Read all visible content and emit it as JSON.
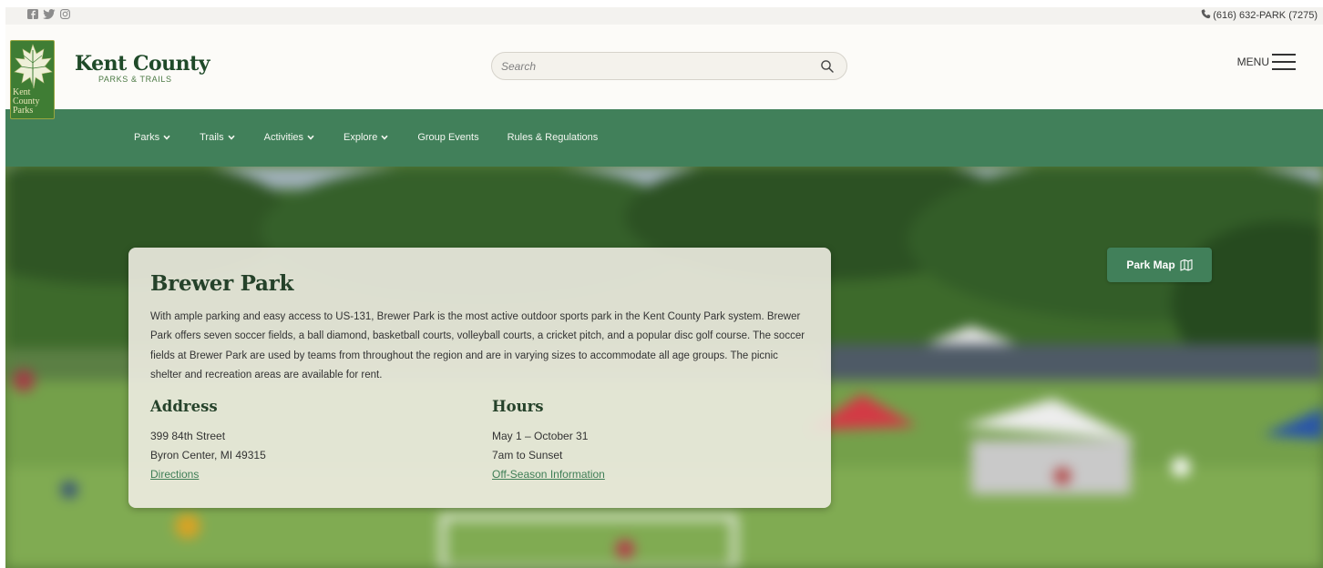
{
  "utility": {
    "social": [
      {
        "name": "facebook-icon"
      },
      {
        "name": "twitter-icon"
      },
      {
        "name": "instagram-icon"
      }
    ],
    "phone": "(616) 632-PARK (7275)"
  },
  "brand": {
    "title": "Kent County",
    "subtitle": "PARKS & TRAILS",
    "badge_text": [
      "Kent",
      "County",
      "Parks"
    ]
  },
  "search": {
    "placeholder": "Search"
  },
  "menu": {
    "label": "MENU"
  },
  "nav": {
    "items": [
      {
        "label": "Parks",
        "dropdown": true
      },
      {
        "label": "Trails",
        "dropdown": true
      },
      {
        "label": "Activities",
        "dropdown": true
      },
      {
        "label": "Explore",
        "dropdown": true
      },
      {
        "label": "Group Events",
        "dropdown": false
      },
      {
        "label": "Rules & Regulations",
        "dropdown": false
      }
    ]
  },
  "park": {
    "title": "Brewer Park",
    "description": "With ample parking and easy access to US-131, Brewer Park is the most active outdoor sports park in the Kent County Park system.  Brewer Park offers seven soccer fields, a ball diamond, basketball courts, volleyball courts, a cricket pitch, and a popular disc golf course. The soccer fields at Brewer Park are used by teams from throughout the region and are in varying sizes to accommodate all age groups. The picnic shelter and recreation areas are available for rent.",
    "address": {
      "heading": "Address",
      "line1": "399 84th Street",
      "line2": "Byron Center, MI 49315",
      "link": "Directions"
    },
    "hours": {
      "heading": "Hours",
      "line1": "May 1 – October 31",
      "line2": "7am to Sunset",
      "link": "Off-Season Information"
    },
    "map_button": "Park Map"
  },
  "colors": {
    "brand_green": "#41805a",
    "dark_green": "#25422a",
    "link_green": "#3f7e56"
  }
}
